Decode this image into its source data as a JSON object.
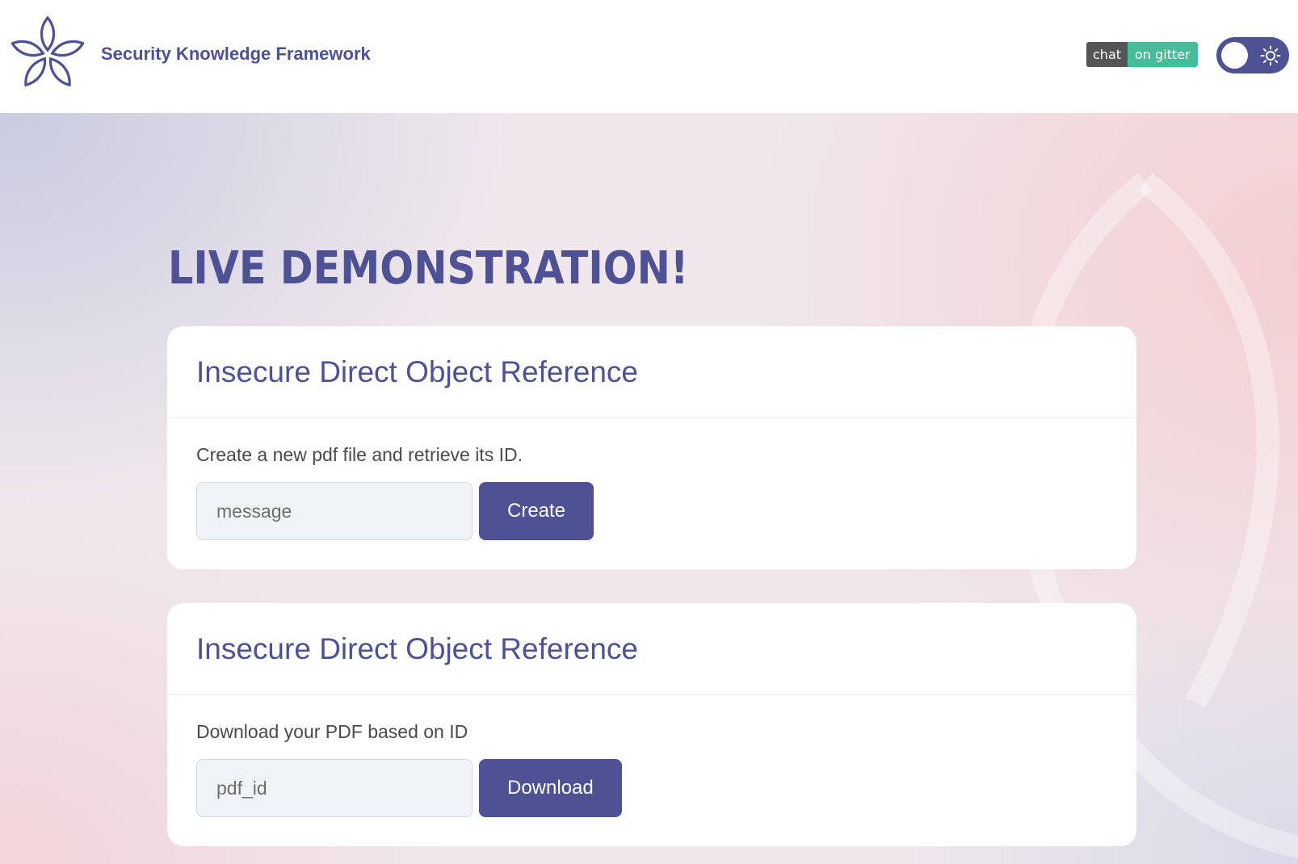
{
  "header": {
    "brand": "Security Knowledge Framework",
    "gitter_left": "chat",
    "gitter_right": "on gitter",
    "theme_toggle_icon": "sun-icon"
  },
  "main": {
    "title": "LIVE DEMONSTRATION!",
    "cards": [
      {
        "title": "Insecure Direct Object Reference",
        "text": "Create a new pdf file and retrieve its ID.",
        "input_placeholder": "message",
        "button_label": "Create"
      },
      {
        "title": "Insecure Direct Object Reference",
        "text": "Download your PDF based on ID",
        "input_placeholder": "pdf_id",
        "button_label": "Download"
      }
    ]
  },
  "colors": {
    "accent": "#4e5193",
    "gitter_left_bg": "#555555",
    "gitter_right_bg": "#46bc99"
  }
}
